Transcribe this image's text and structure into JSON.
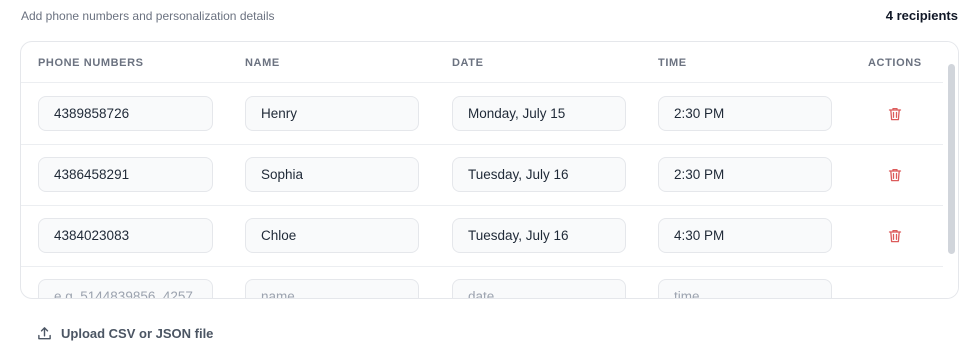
{
  "header": {
    "subtitle": "Add phone numbers and personalization details",
    "recipient_count": "4 recipients"
  },
  "table": {
    "columns": {
      "phone": "PHONE NUMBERS",
      "name": "NAME",
      "date": "DATE",
      "time": "TIME",
      "actions": "ACTIONS"
    },
    "rows": [
      {
        "phone": "4389858726",
        "name": "Henry",
        "date": "Monday, July 15",
        "time": "2:30 PM"
      },
      {
        "phone": "4386458291",
        "name": "Sophia",
        "date": "Tuesday, July 16",
        "time": "2:30 PM"
      },
      {
        "phone": "4384023083",
        "name": "Chloe",
        "date": "Tuesday, July 16",
        "time": "4:30 PM"
      }
    ],
    "new_row_placeholders": {
      "phone": "e.g. 5144839856, 4257...",
      "name": "name",
      "date": "date",
      "time": "time"
    }
  },
  "upload": {
    "label": "Upload CSV or JSON file",
    "icon": "upload-icon"
  },
  "colors": {
    "delete_icon": "#dc5b5b",
    "border": "#e5e7eb",
    "input_bg": "#f9fafb"
  }
}
